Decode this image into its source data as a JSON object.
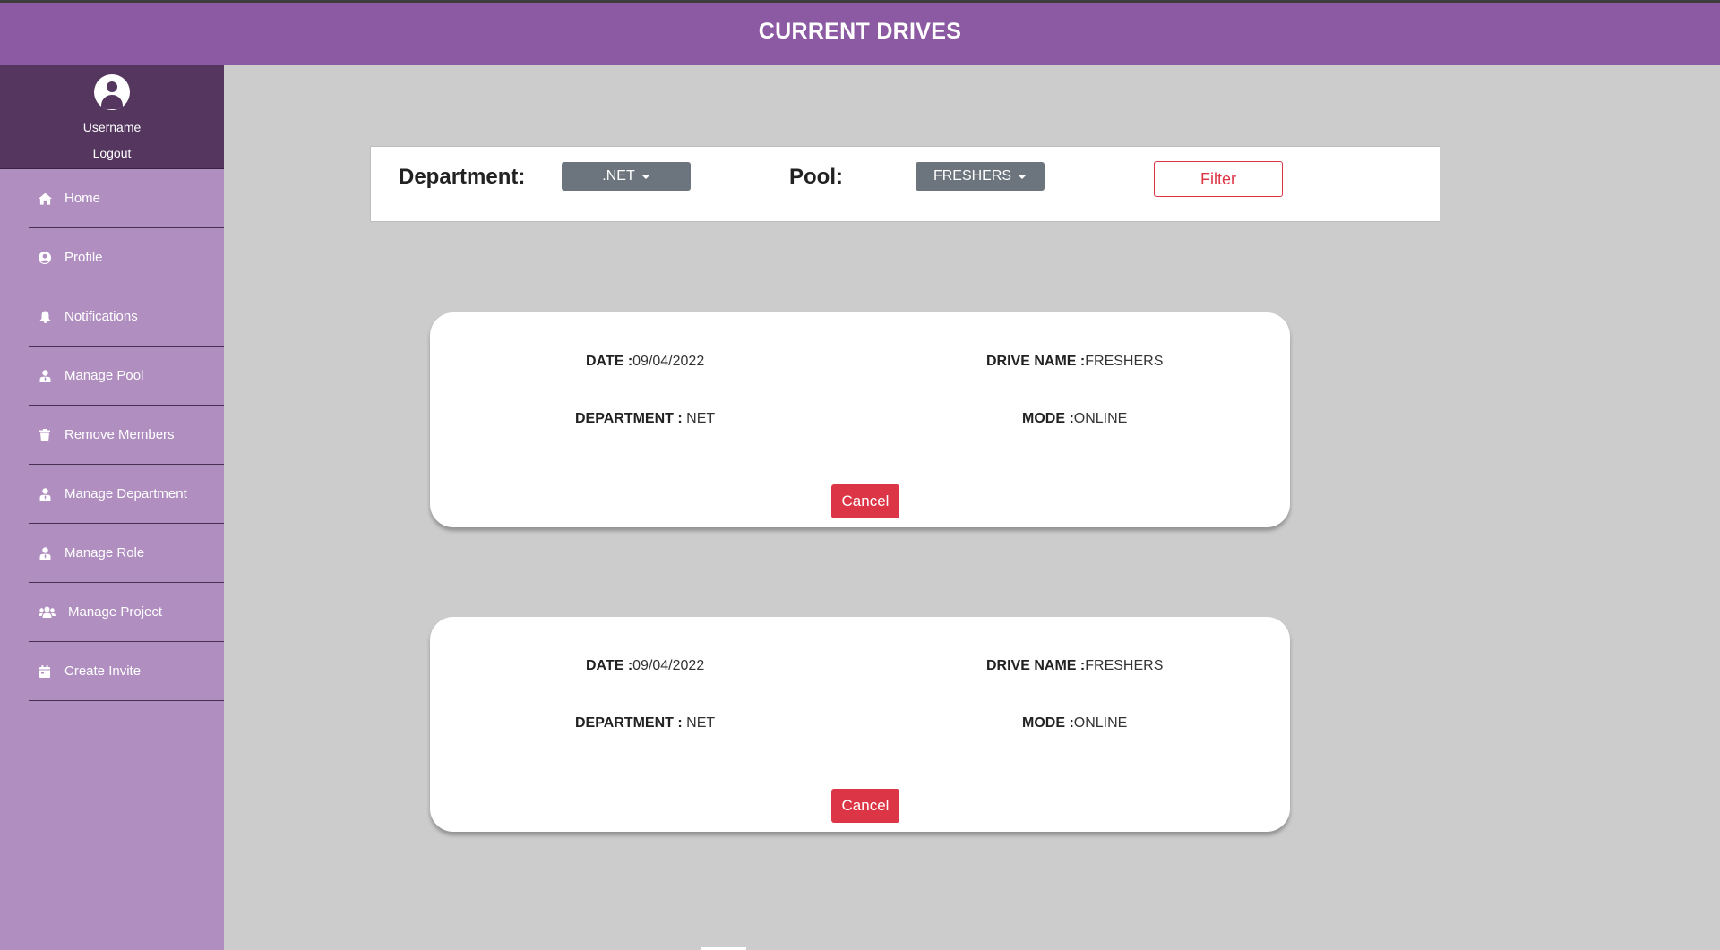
{
  "header": {
    "title": "CURRENT DRIVES"
  },
  "sidebar": {
    "username": "Username",
    "logout_label": "Logout",
    "items": [
      {
        "label": "Home",
        "icon": "home-icon"
      },
      {
        "label": "Profile",
        "icon": "user-circle-icon"
      },
      {
        "label": "Notifications",
        "icon": "bell-icon"
      },
      {
        "label": "Manage Pool",
        "icon": "user-tie-icon"
      },
      {
        "label": "Remove Members",
        "icon": "trash-icon"
      },
      {
        "label": "Manage Department",
        "icon": "user-tie-icon"
      },
      {
        "label": "Manage Role",
        "icon": "user-tie-icon"
      },
      {
        "label": "Manage Project",
        "icon": "users-icon"
      },
      {
        "label": "Create Invite",
        "icon": "calendar-icon"
      }
    ]
  },
  "filters": {
    "department_label": "Department:",
    "department_value": ".NET",
    "pool_label": "Pool:",
    "pool_value": "FRESHERS",
    "filter_button": "Filter"
  },
  "drives": [
    {
      "date_label": "DATE :",
      "date": "09/04/2022",
      "drive_name_label": "DRIVE NAME :",
      "drive_name": "FRESHERS",
      "department_label": "DEPARTMENT :",
      "department": " NET",
      "mode_label": "MODE :",
      "mode": "ONLINE",
      "cancel_label": "Cancel"
    },
    {
      "date_label": "DATE :",
      "date": "09/04/2022",
      "drive_name_label": "DRIVE NAME :",
      "drive_name": "FRESHERS",
      "department_label": "DEPARTMENT :",
      "department": " NET",
      "mode_label": "MODE :",
      "mode": "ONLINE",
      "cancel_label": "Cancel"
    }
  ],
  "colors": {
    "header": "#8c5aa3",
    "sidebar": "#b08fc0",
    "user_box": "#54365f",
    "danger": "#dc3545",
    "dropdown": "#6c757d",
    "background": "#cccccc"
  }
}
